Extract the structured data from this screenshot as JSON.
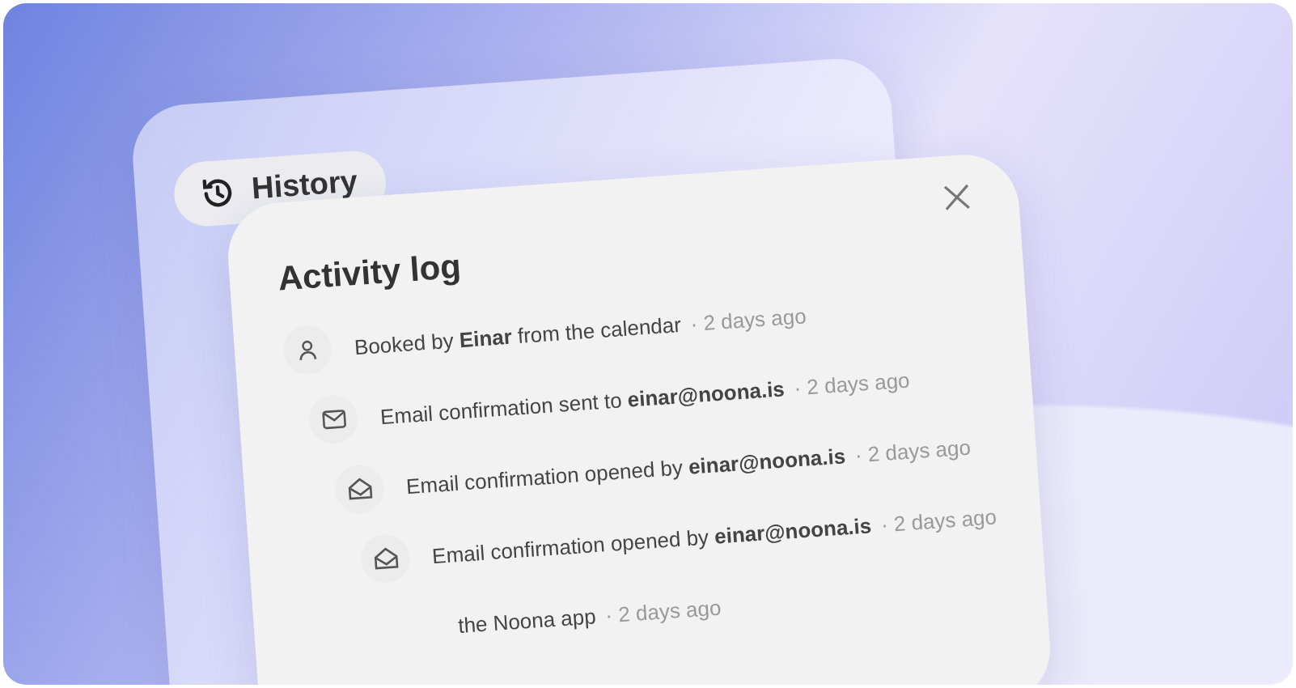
{
  "history_card": {
    "badge": "History"
  },
  "activity_log": {
    "title": "Activity log",
    "entries": [
      {
        "kind": "person",
        "text": "Booked by **Einar** from the calendar",
        "time": "· 2 days ago"
      },
      {
        "kind": "mail",
        "text": "Email confirmation sent to **einar@noona.is**",
        "time": "· 2 days ago"
      },
      {
        "kind": "mail-open",
        "text": "Email confirmation opened by **einar@noona.is**",
        "time": "· 2 days ago"
      },
      {
        "kind": "mail-open",
        "text": "Email confirmation opened by **einar@noona.is**",
        "time": "· 2 days ago"
      },
      {
        "kind": "app",
        "text": "the Noona app",
        "time": "· 2 days ago"
      }
    ]
  }
}
